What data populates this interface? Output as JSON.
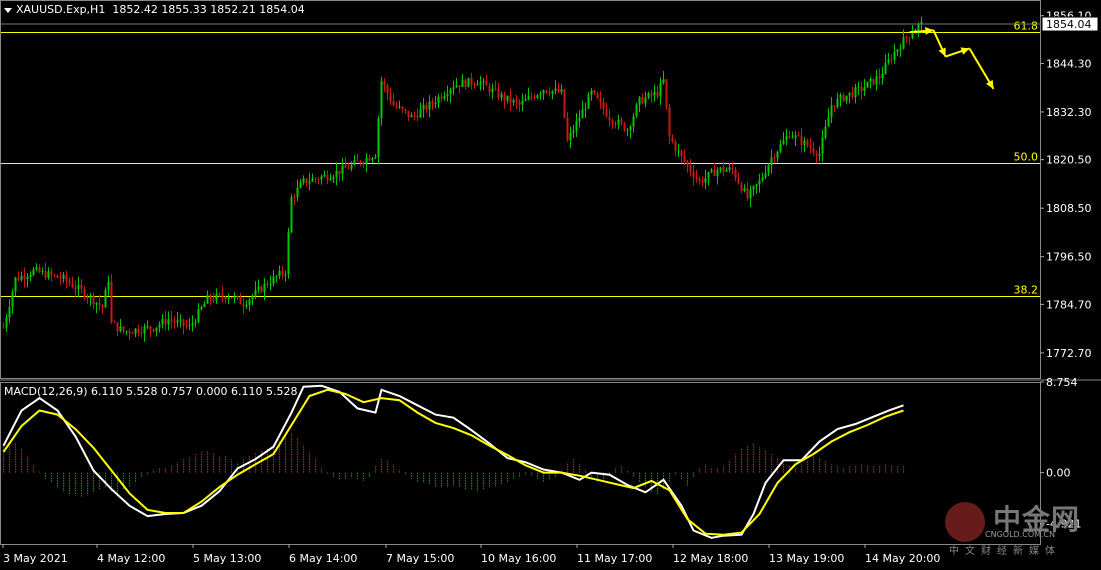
{
  "header": {
    "symbol": "XAUUSD.Exp,H1",
    "ohlc": "1852.42 1855.33 1852.21 1854.04"
  },
  "macd_header": "MACD(12,26,9) 6.110 5.528 0.757 0.000 6.110 5.528",
  "colors": {
    "background": "#000000",
    "bull": "#00c800",
    "bear": "#c81818",
    "fibo": "#ffff00",
    "macd_main": "#ffffff",
    "macd_signal": "#ffff00",
    "hist_pos": "#a52a2a",
    "hist_neg": "#2e7d2e",
    "arrow": "#ffff00"
  },
  "logo": {
    "name": "中金网",
    "url": "CNGOLD.COM.CN",
    "tagline": "中文财经新媒体"
  },
  "chart_data": [
    {
      "type": "candlestick",
      "symbol": "XAUUSD.Exp",
      "timeframe": "H1",
      "ylim": [
        1766.5,
        1858.5
      ],
      "yticks": [
        1856.1,
        1844.3,
        1832.3,
        1820.5,
        1808.5,
        1796.5,
        1784.7,
        1772.7
      ],
      "xticks": [
        "3 May 2021",
        "4 May 12:00",
        "5 May 13:00",
        "6 May 14:00",
        "7 May 15:00",
        "10 May 16:00",
        "11 May 17:00",
        "12 May 18:00",
        "13 May 19:00",
        "14 May 20:00"
      ],
      "current_price": 1854.04,
      "fibonacci": [
        {
          "label": "61.8",
          "price": 1852.0
        },
        {
          "label": "50.0",
          "price": 1819.7
        },
        {
          "label": "38.2",
          "price": 1786.7
        }
      ],
      "close_path": [
        [
          0,
          1779
        ],
        [
          4,
          1791
        ],
        [
          10,
          1793
        ],
        [
          20,
          1791
        ],
        [
          28,
          1787
        ],
        [
          33,
          1784
        ],
        [
          35,
          1791
        ],
        [
          36,
          1780
        ],
        [
          40,
          1778
        ],
        [
          50,
          1779
        ],
        [
          55,
          1781
        ],
        [
          62,
          1779
        ],
        [
          68,
          1786
        ],
        [
          75,
          1787
        ],
        [
          80,
          1785
        ],
        [
          88,
          1790
        ],
        [
          94,
          1793
        ],
        [
          96,
          1811
        ],
        [
          100,
          1815
        ],
        [
          110,
          1817
        ],
        [
          116,
          1819
        ],
        [
          124,
          1822
        ],
        [
          126,
          1840
        ],
        [
          130,
          1834
        ],
        [
          136,
          1831
        ],
        [
          142,
          1834
        ],
        [
          150,
          1839
        ],
        [
          158,
          1840
        ],
        [
          166,
          1836
        ],
        [
          172,
          1834
        ],
        [
          180,
          1838
        ],
        [
          186,
          1837
        ],
        [
          188,
          1825
        ],
        [
          192,
          1831
        ],
        [
          196,
          1837
        ],
        [
          202,
          1831
        ],
        [
          208,
          1828
        ],
        [
          212,
          1835
        ],
        [
          218,
          1837
        ],
        [
          220,
          1840
        ],
        [
          222,
          1826
        ],
        [
          226,
          1821
        ],
        [
          232,
          1815
        ],
        [
          238,
          1818
        ],
        [
          243,
          1818
        ],
        [
          248,
          1811
        ],
        [
          252,
          1815
        ],
        [
          256,
          1821
        ],
        [
          262,
          1827
        ],
        [
          268,
          1824
        ],
        [
          272,
          1822
        ],
        [
          276,
          1834
        ],
        [
          280,
          1836
        ],
        [
          286,
          1838
        ],
        [
          292,
          1841
        ],
        [
          296,
          1846
        ],
        [
          300,
          1850
        ],
        [
          304,
          1853
        ],
        [
          306,
          1854
        ]
      ],
      "projection_arrows": [
        [
          [
            302,
            1852
          ],
          [
            310,
            1852.5
          ]
        ],
        [
          [
            310,
            1852.5
          ],
          [
            314,
            1846
          ]
        ],
        [
          [
            314,
            1846
          ],
          [
            322,
            1848
          ]
        ],
        [
          [
            322,
            1848
          ],
          [
            330,
            1838
          ]
        ]
      ]
    },
    {
      "type": "line",
      "name": "MACD(12,26,9)",
      "ylim": [
        -6.9,
        8.754
      ],
      "yticks": [
        8.754,
        0.0,
        -4.921
      ],
      "series": [
        {
          "name": "main",
          "points": [
            [
              0,
              2.6
            ],
            [
              6,
              6.0
            ],
            [
              12,
              7.2
            ],
            [
              18,
              6.0
            ],
            [
              24,
              3.5
            ],
            [
              30,
              0.2
            ],
            [
              36,
              -1.6
            ],
            [
              42,
              -3.2
            ],
            [
              48,
              -4.2
            ],
            [
              54,
              -4.0
            ],
            [
              60,
              -3.9
            ],
            [
              66,
              -3.2
            ],
            [
              72,
              -1.8
            ],
            [
              78,
              0.4
            ],
            [
              84,
              1.3
            ],
            [
              90,
              2.5
            ],
            [
              96,
              5.8
            ],
            [
              100,
              8.3
            ],
            [
              106,
              8.4
            ],
            [
              112,
              7.8
            ],
            [
              118,
              6.2
            ],
            [
              124,
              5.8
            ],
            [
              126,
              8.0
            ],
            [
              132,
              7.4
            ],
            [
              138,
              6.5
            ],
            [
              144,
              5.6
            ],
            [
              150,
              5.3
            ],
            [
              156,
              4.1
            ],
            [
              162,
              2.8
            ],
            [
              168,
              1.4
            ],
            [
              174,
              1.0
            ],
            [
              180,
              0.3
            ],
            [
              186,
              0.0
            ],
            [
              192,
              -0.7
            ],
            [
              196,
              0.0
            ],
            [
              202,
              -0.2
            ],
            [
              208,
              -1.2
            ],
            [
              214,
              -1.9
            ],
            [
              220,
              -0.7
            ],
            [
              226,
              -3.2
            ],
            [
              230,
              -5.6
            ],
            [
              236,
              -6.3
            ],
            [
              240,
              -6.1
            ],
            [
              246,
              -6.0
            ],
            [
              250,
              -4.0
            ],
            [
              254,
              -1.0
            ],
            [
              260,
              1.2
            ],
            [
              266,
              1.2
            ],
            [
              272,
              3.0
            ],
            [
              278,
              4.2
            ],
            [
              284,
              4.7
            ],
            [
              290,
              5.4
            ],
            [
              296,
              6.1
            ],
            [
              300,
              6.5
            ]
          ]
        },
        {
          "name": "signal",
          "points": [
            [
              0,
              2.0
            ],
            [
              6,
              4.5
            ],
            [
              12,
              6.0
            ],
            [
              18,
              5.6
            ],
            [
              24,
              4.2
            ],
            [
              30,
              2.4
            ],
            [
              36,
              0.2
            ],
            [
              42,
              -2.0
            ],
            [
              48,
              -3.6
            ],
            [
              54,
              -3.9
            ],
            [
              60,
              -3.9
            ],
            [
              66,
              -2.8
            ],
            [
              72,
              -1.4
            ],
            [
              78,
              -0.2
            ],
            [
              84,
              0.8
            ],
            [
              90,
              1.8
            ],
            [
              96,
              4.6
            ],
            [
              102,
              7.4
            ],
            [
              108,
              8.0
            ],
            [
              114,
              7.6
            ],
            [
              120,
              6.8
            ],
            [
              126,
              7.2
            ],
            [
              132,
              7.0
            ],
            [
              138,
              5.8
            ],
            [
              144,
              4.8
            ],
            [
              150,
              4.3
            ],
            [
              156,
              3.6
            ],
            [
              162,
              2.6
            ],
            [
              168,
              1.7
            ],
            [
              174,
              0.7
            ],
            [
              180,
              0.0
            ],
            [
              186,
              0.0
            ],
            [
              192,
              -0.3
            ],
            [
              198,
              -0.7
            ],
            [
              204,
              -1.1
            ],
            [
              210,
              -1.5
            ],
            [
              216,
              -0.8
            ],
            [
              222,
              -1.7
            ],
            [
              228,
              -4.5
            ],
            [
              234,
              -5.9
            ],
            [
              240,
              -6.0
            ],
            [
              246,
              -5.8
            ],
            [
              252,
              -4.0
            ],
            [
              258,
              -1.0
            ],
            [
              264,
              0.8
            ],
            [
              270,
              1.8
            ],
            [
              276,
              3.0
            ],
            [
              282,
              3.9
            ],
            [
              288,
              4.6
            ],
            [
              294,
              5.4
            ],
            [
              300,
              6.0
            ]
          ]
        }
      ],
      "histogram": [
        [
          0,
          2.7
        ],
        [
          2,
          2.9
        ],
        [
          4,
          2.8
        ],
        [
          6,
          2.4
        ],
        [
          8,
          1.6
        ],
        [
          10,
          0.8
        ],
        [
          12,
          0.1
        ],
        [
          14,
          -0.6
        ],
        [
          16,
          -1.0
        ],
        [
          18,
          -1.5
        ],
        [
          20,
          -1.8
        ],
        [
          22,
          -2.1
        ],
        [
          24,
          -2.2
        ],
        [
          26,
          -2.4
        ],
        [
          28,
          -2.2
        ],
        [
          30,
          -1.9
        ],
        [
          32,
          -1.6
        ],
        [
          34,
          -1.5
        ],
        [
          36,
          -1.8
        ],
        [
          38,
          -2.0
        ],
        [
          40,
          -1.7
        ],
        [
          42,
          -1.4
        ],
        [
          44,
          -0.9
        ],
        [
          46,
          -0.5
        ],
        [
          48,
          -0.2
        ],
        [
          50,
          0.3
        ],
        [
          52,
          0.5
        ],
        [
          54,
          0.4
        ],
        [
          56,
          0.7
        ],
        [
          58,
          1.0
        ],
        [
          60,
          1.3
        ],
        [
          62,
          1.5
        ],
        [
          64,
          1.8
        ],
        [
          66,
          2.0
        ],
        [
          68,
          2.1
        ],
        [
          70,
          1.9
        ],
        [
          72,
          1.7
        ],
        [
          74,
          1.6
        ],
        [
          76,
          1.3
        ],
        [
          78,
          1.0
        ],
        [
          80,
          1.4
        ],
        [
          82,
          1.7
        ],
        [
          84,
          1.9
        ],
        [
          86,
          2.2
        ],
        [
          88,
          2.4
        ],
        [
          90,
          2.7
        ],
        [
          92,
          3.1
        ],
        [
          94,
          3.6
        ],
        [
          96,
          3.9
        ],
        [
          98,
          3.4
        ],
        [
          100,
          2.7
        ],
        [
          102,
          2.0
        ],
        [
          104,
          1.3
        ],
        [
          106,
          0.5
        ],
        [
          108,
          -0.1
        ],
        [
          110,
          -0.5
        ],
        [
          112,
          -0.7
        ],
        [
          114,
          -0.6
        ],
        [
          116,
          -0.5
        ],
        [
          118,
          -0.6
        ],
        [
          120,
          -0.8
        ],
        [
          122,
          -0.5
        ],
        [
          124,
          0.6
        ],
        [
          126,
          1.3
        ],
        [
          128,
          1.1
        ],
        [
          130,
          0.8
        ],
        [
          132,
          0.3
        ],
        [
          134,
          -0.2
        ],
        [
          136,
          -0.6
        ],
        [
          138,
          -0.9
        ],
        [
          140,
          -1.0
        ],
        [
          142,
          -1.2
        ],
        [
          144,
          -1.4
        ],
        [
          146,
          -1.5
        ],
        [
          148,
          -1.4
        ],
        [
          150,
          -1.3
        ],
        [
          152,
          -1.4
        ],
        [
          154,
          -1.6
        ],
        [
          156,
          -1.7
        ],
        [
          158,
          -1.8
        ],
        [
          160,
          -1.6
        ],
        [
          162,
          -1.4
        ],
        [
          164,
          -1.3
        ],
        [
          166,
          -1.1
        ],
        [
          168,
          -0.9
        ],
        [
          170,
          -0.6
        ],
        [
          172,
          -0.4
        ],
        [
          174,
          -0.2
        ],
        [
          176,
          -0.3
        ],
        [
          178,
          -0.6
        ],
        [
          180,
          -0.9
        ],
        [
          182,
          -0.7
        ],
        [
          184,
          -0.4
        ],
        [
          186,
          0.3
        ],
        [
          188,
          0.9
        ],
        [
          190,
          1.3
        ],
        [
          192,
          0.9
        ],
        [
          194,
          0.3
        ],
        [
          196,
          -0.4
        ],
        [
          198,
          -0.9
        ],
        [
          200,
          -0.8
        ],
        [
          202,
          -0.3
        ],
        [
          204,
          0.4
        ],
        [
          206,
          0.6
        ],
        [
          208,
          0.2
        ],
        [
          210,
          -0.4
        ],
        [
          212,
          -0.9
        ],
        [
          214,
          -1.4
        ],
        [
          216,
          -1.9
        ],
        [
          218,
          -2.2
        ],
        [
          220,
          -1.6
        ],
        [
          222,
          -0.9
        ],
        [
          224,
          -0.2
        ],
        [
          226,
          -0.7
        ],
        [
          228,
          -1.3
        ],
        [
          230,
          -0.5
        ],
        [
          232,
          0.4
        ],
        [
          234,
          0.8
        ],
        [
          236,
          0.5
        ],
        [
          238,
          0.4
        ],
        [
          240,
          0.6
        ],
        [
          242,
          1.2
        ],
        [
          244,
          1.8
        ],
        [
          246,
          2.3
        ],
        [
          248,
          2.6
        ],
        [
          250,
          2.8
        ],
        [
          252,
          2.5
        ],
        [
          254,
          2.2
        ],
        [
          256,
          1.8
        ],
        [
          258,
          1.4
        ],
        [
          260,
          1.0
        ],
        [
          262,
          0.7
        ],
        [
          264,
          0.5
        ],
        [
          266,
          0.8
        ],
        [
          268,
          1.2
        ],
        [
          270,
          1.6
        ],
        [
          272,
          1.4
        ],
        [
          274,
          1.1
        ],
        [
          276,
          0.8
        ],
        [
          278,
          0.6
        ],
        [
          280,
          0.5
        ],
        [
          282,
          0.6
        ],
        [
          284,
          0.7
        ],
        [
          286,
          0.8
        ],
        [
          288,
          0.7
        ],
        [
          290,
          0.6
        ],
        [
          292,
          0.7
        ],
        [
          294,
          0.8
        ],
        [
          296,
          0.7
        ],
        [
          298,
          0.6
        ],
        [
          300,
          0.7
        ]
      ]
    }
  ]
}
